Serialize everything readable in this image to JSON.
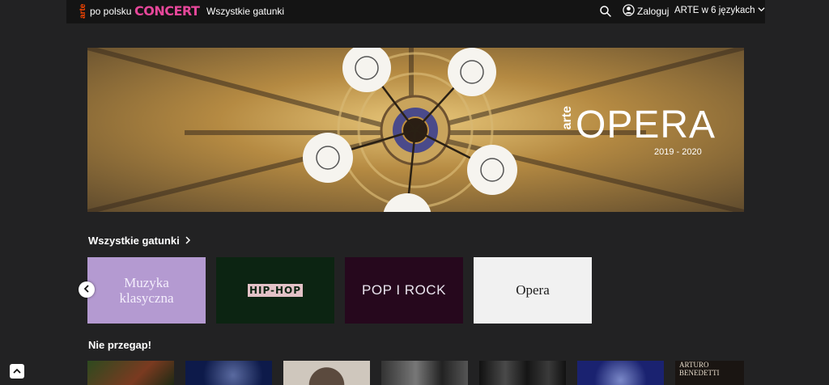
{
  "topbar": {
    "logo_text": "arte",
    "lang_label": "po polsku",
    "concert_logo": "CONCERT",
    "nav_genres": "Wszystkie gatunki",
    "search_icon": "search-icon",
    "login_label": "Zaloguj",
    "language_selector": "ARTE w 6 językach"
  },
  "hero": {
    "brand": "arte",
    "title": "OPERA",
    "season": "2019 - 2020"
  },
  "genres_section": {
    "title": "Wszystkie gatunki",
    "items": [
      {
        "label": "Muzyka klasyczna",
        "color": "#b49ad1"
      },
      {
        "label": "HIP-HOP",
        "color": "#0c2412"
      },
      {
        "label": "POP I ROCK",
        "color": "#26081d"
      },
      {
        "label": "Opera",
        "color": "#f1f1f1"
      }
    ]
  },
  "highlights_section": {
    "title": "Nie przegap!",
    "thumb_text": "ARTURO BENEDETTI"
  },
  "colors": {
    "background": "#222223",
    "topbar": "#141414",
    "arte_orange": "#fd4600",
    "concert_pink": "#e6479a"
  }
}
